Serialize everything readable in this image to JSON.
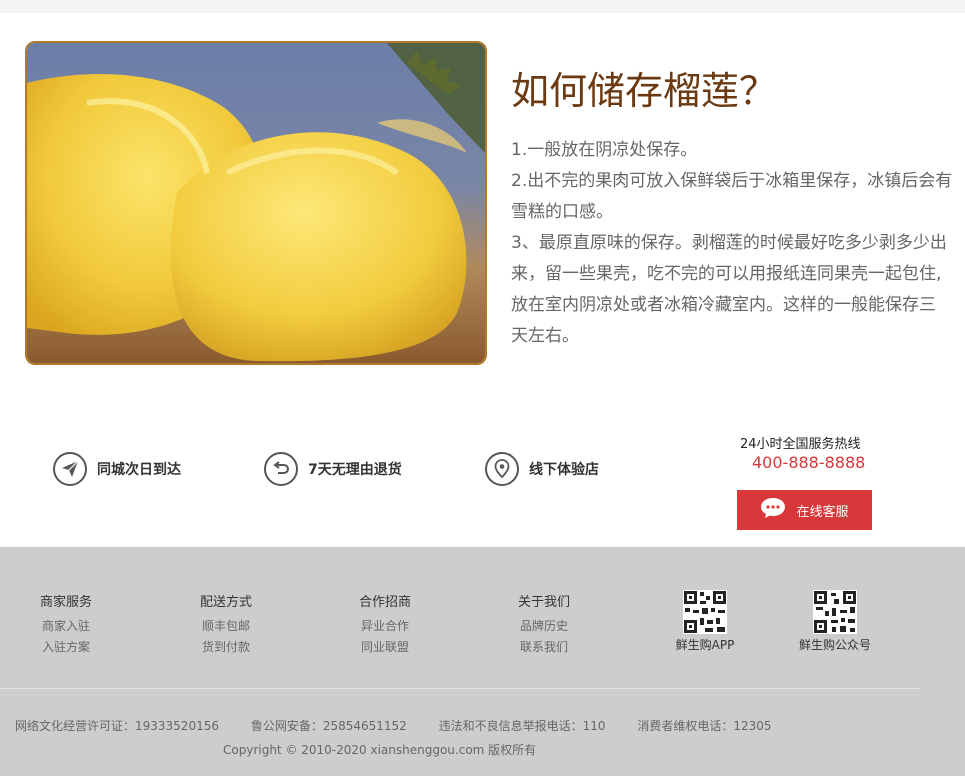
{
  "article": {
    "title": "如何储存榴莲？",
    "paragraphs": [
      "1.一般放在阴凉处保存。",
      "2.出不完的果肉可放入保鲜袋后于冰箱里保存，冰镇后会有",
      "雪糕的口感。",
      "3、最原直原味的保存。剥榴莲的时候最好吃多少剥多少出",
      "来，留一些果壳，吃不完的可以用报纸连同果壳一起包住,",
      "放在室内阴凉处或者冰箱冷藏室内。这样的一般能保存三",
      "天左右。"
    ]
  },
  "features": [
    {
      "label": "同城次日到达",
      "icon": "paper-plane-icon"
    },
    {
      "label": "7天无理由退货",
      "icon": "return-arrow-icon"
    },
    {
      "label": "线下体验店",
      "icon": "location-pin-icon"
    }
  ],
  "hotline": {
    "label": "24小时全国服务热线",
    "number": "400-888-8888"
  },
  "service_button": {
    "label": "在线客服",
    "icon": "chat-bubble-icon"
  },
  "footer": {
    "columns": [
      {
        "title": "商家服务",
        "links": [
          "商家入驻",
          "入驻方案"
        ]
      },
      {
        "title": "配送方式",
        "links": [
          "顺丰包邮",
          "货到付款"
        ]
      },
      {
        "title": "合作招商",
        "links": [
          "异业合作",
          "同业联盟"
        ]
      },
      {
        "title": "关于我们",
        "links": [
          "品牌历史",
          "联系我们"
        ]
      }
    ],
    "qrcodes": [
      {
        "label": "鲜生购APP",
        "icon": "qr-code-icon"
      },
      {
        "label": "鲜生购公众号",
        "icon": "qr-code-icon"
      }
    ],
    "legal": [
      "网络文化经营许可证：19333520156",
      "鲁公网安备：25854651152",
      "违法和不良信息举报电话：110",
      "消费者维权电话：12305"
    ],
    "copyright": "Copyright © 2010-2020 xianshenggou.com 版权所有"
  },
  "colors": {
    "accent": "#d9383a",
    "title": "#6b3a12",
    "frame": "#b07a2a",
    "footer_bg": "#cdcdcd"
  }
}
